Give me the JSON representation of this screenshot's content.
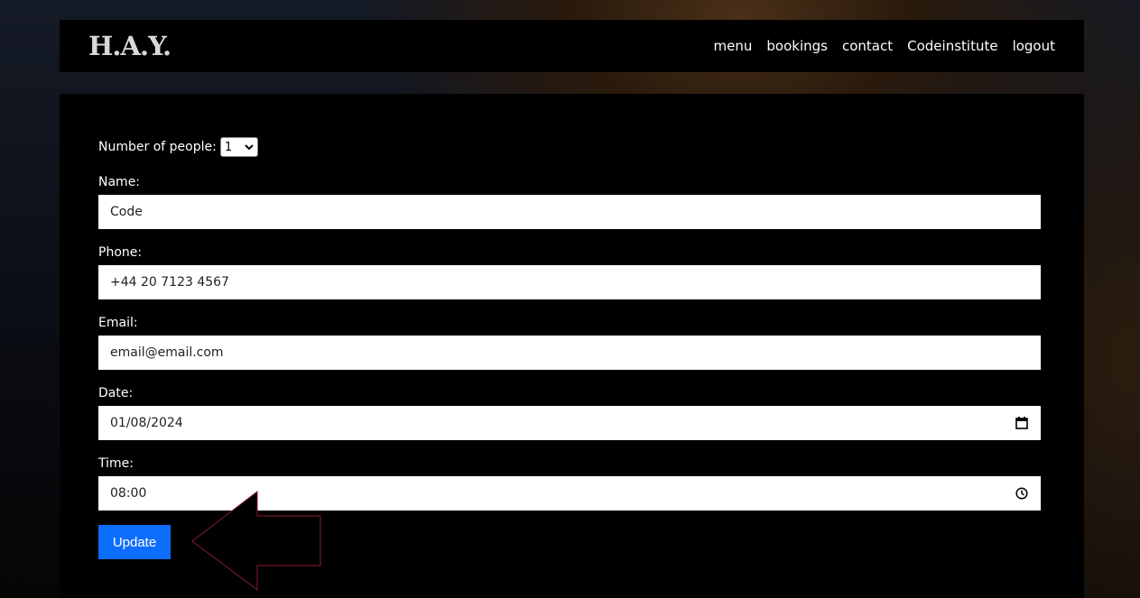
{
  "brand": "H.A.Y.",
  "nav": [
    "menu",
    "bookings",
    "contact",
    "Codeinstitute",
    "logout"
  ],
  "form": {
    "people_label": "Number of people:",
    "people_value": "1",
    "name_label": "Name:",
    "name_value": "Code",
    "phone_label": "Phone:",
    "phone_value": "+44 20 7123 4567",
    "email_label": "Email:",
    "email_value": "email@email.com",
    "date_label": "Date:",
    "date_value": "01/08/2024",
    "time_label": "Time:",
    "time_value": "08:00",
    "submit_label": "Update"
  },
  "colors": {
    "accent": "#0d6efd",
    "arrow_outline": "#8b1a2a"
  },
  "icons": {
    "date": "calendar-icon",
    "time": "clock-icon",
    "select": "chevron-down-icon"
  }
}
